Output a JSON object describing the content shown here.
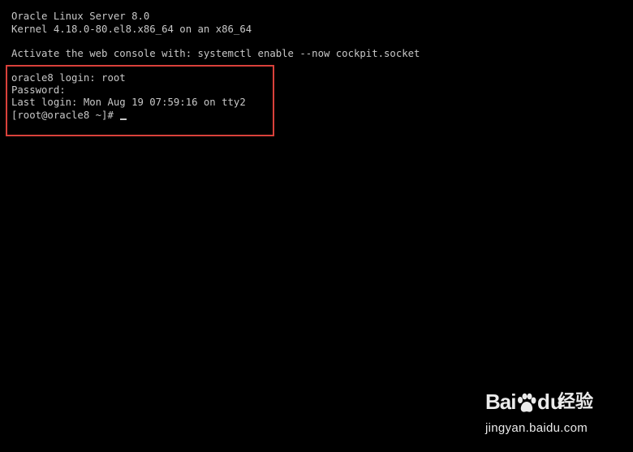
{
  "terminal": {
    "header_lines": [
      "Oracle Linux Server 8.0",
      "Kernel 4.18.0-80.el8.x86_64 on an x86_64"
    ],
    "activate_line": "Activate the web console with: systemctl enable --now cockpit.socket",
    "login_lines": [
      "oracle8 login: root",
      "Password:",
      "Last login: Mon Aug 19 07:59:16 on tty2"
    ],
    "prompt": "[root@oracle8 ~]# "
  },
  "highlight": {
    "color": "#d9413b"
  },
  "watermark": {
    "brand_bai": "Bai",
    "brand_du": "du",
    "brand_jingyan": "经验",
    "url": "jingyan.baidu.com"
  },
  "colors": {
    "background": "#000000",
    "text": "#c8c8c8"
  }
}
